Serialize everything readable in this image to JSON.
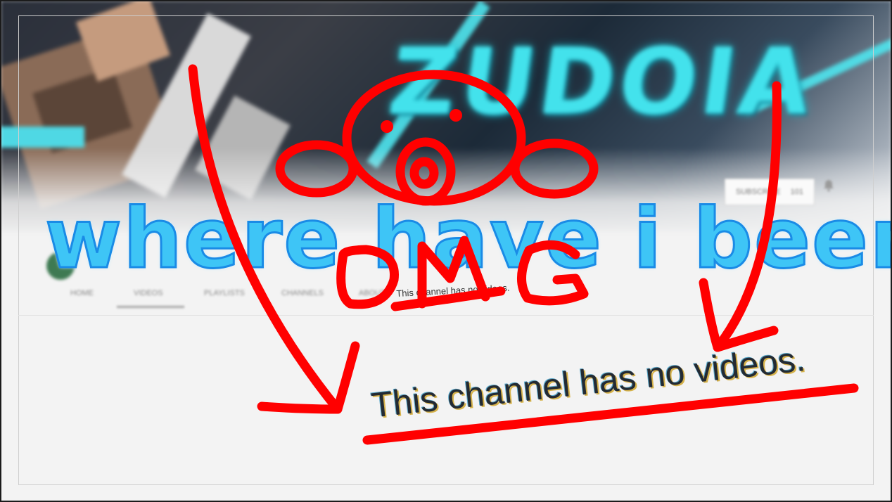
{
  "headline": {
    "text": "where have i been"
  },
  "banner": {
    "logo_text": "ZUDOIA"
  },
  "subscribe": {
    "label": "SUBSCRIBE",
    "count": "101"
  },
  "channel_tabs": [
    {
      "label": "HOME"
    },
    {
      "label": "VIDEOS"
    },
    {
      "label": "PLAYLISTS"
    },
    {
      "label": "CHANNELS"
    },
    {
      "label": "ABOUT"
    }
  ],
  "empty_state": {
    "small_text": "This channel has no videos.",
    "large_text": "This channel has no videos."
  },
  "doodle": {
    "text": "OMG"
  },
  "colors": {
    "headline_fill": "#3ec5f6",
    "headline_stroke": "#1a8be6",
    "annotation_red": "#ff0000",
    "logo_cyan": "#43e2ec"
  }
}
